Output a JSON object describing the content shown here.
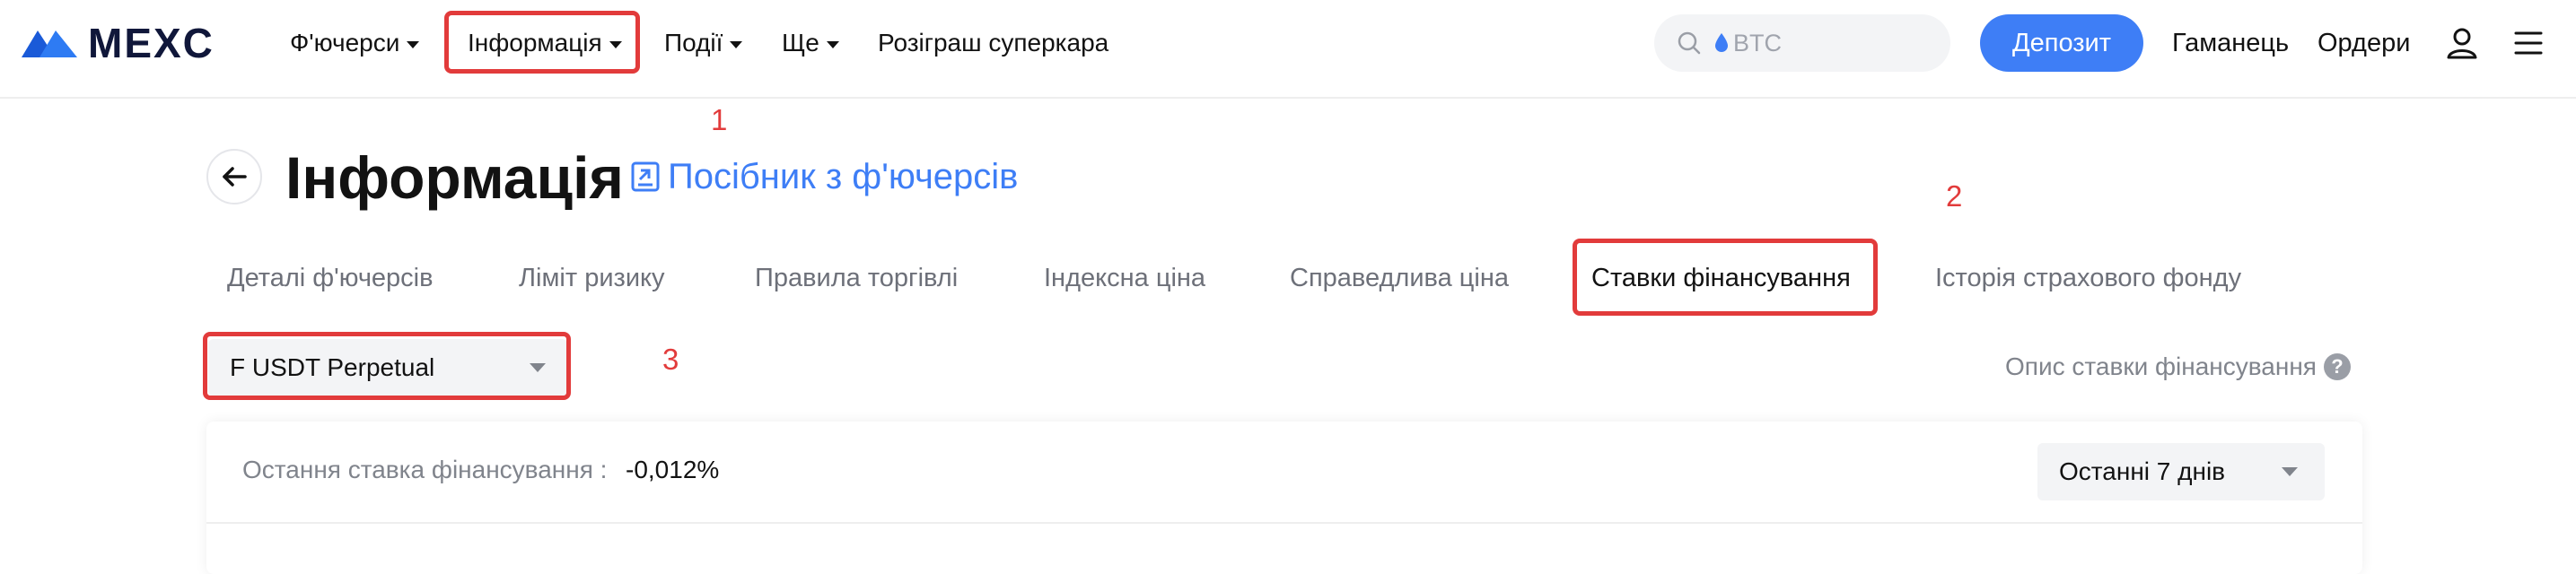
{
  "brand": {
    "name": "MEXC",
    "accent": "#3e7ef6",
    "annotation_color": "#e23b3b"
  },
  "nav": {
    "futures": "Ф'ючерси",
    "info": "Інформація",
    "events": "Події",
    "more": "Ще",
    "supercar": "Розіграш суперкара"
  },
  "search": {
    "placeholder": "BTC",
    "icon": "search-icon"
  },
  "header_actions": {
    "deposit": "Депозит",
    "wallet": "Гаманець",
    "orders": "Ордери",
    "user_icon": "user-icon",
    "menu_icon": "menu-icon"
  },
  "page": {
    "title": "Інформація",
    "guide_link": "Посібник з ф'ючерсів"
  },
  "tabs": [
    {
      "label": "Деталі ф'ючерсів"
    },
    {
      "label": "Ліміт ризику"
    },
    {
      "label": "Правила торгівлі"
    },
    {
      "label": "Індексна ціна"
    },
    {
      "label": "Справедлива ціна"
    },
    {
      "label": "Ставки фінансування",
      "active": true
    },
    {
      "label": "Історія страхового фонду"
    }
  ],
  "contract_select": {
    "value": "F USDT Perpetual"
  },
  "funding_description": {
    "label": "Опис ставки фінансування",
    "help": "?"
  },
  "card": {
    "last_rate_label": "Остання ставка фінансування :",
    "last_rate_value": "-0,012%",
    "period": "Останні 7 днів"
  },
  "annotations": [
    "1",
    "2",
    "3"
  ]
}
